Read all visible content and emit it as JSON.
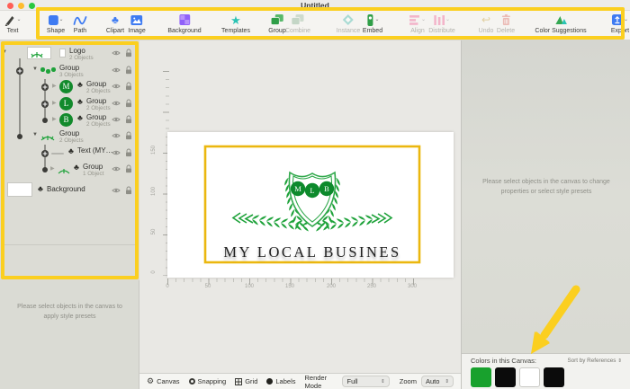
{
  "window": {
    "title": "Untitled"
  },
  "toolbar": {
    "items": [
      {
        "label": "Text"
      },
      {
        "label": "Shape"
      },
      {
        "label": "Path"
      },
      {
        "label": "Clipart"
      },
      {
        "label": "Image"
      },
      {
        "label": "Background"
      },
      {
        "label": "Templates"
      },
      {
        "label": "Group"
      },
      {
        "label": "Combine"
      },
      {
        "label": "Instance"
      },
      {
        "label": "Embed"
      },
      {
        "label": "Align"
      },
      {
        "label": "Distribute"
      },
      {
        "label": "Undo"
      },
      {
        "label": "Delete"
      },
      {
        "label": "Color Suggestions"
      },
      {
        "label": "Export"
      }
    ]
  },
  "layers": {
    "rows": [
      {
        "title": "Logo",
        "sub": "2 Objects"
      },
      {
        "title": "Group",
        "sub": "3 Objects"
      },
      {
        "title": "Group",
        "sub": "2 Objects",
        "badge": "M"
      },
      {
        "title": "Group",
        "sub": "2 Objects",
        "badge": "L"
      },
      {
        "title": "Group",
        "sub": "2 Objects",
        "badge": "B"
      },
      {
        "title": "Group",
        "sub": "2 Objects"
      },
      {
        "title": "Text (MY…",
        "sub": ""
      },
      {
        "title": "Group",
        "sub": "1 Object"
      },
      {
        "title": "Background",
        "sub": ""
      }
    ]
  },
  "left_panel": {
    "message": "Please select objects in the canvas to apply style presets"
  },
  "right_panel": {
    "message": "Please select objects in the canvas to change properties or select style presets",
    "colors_header": "Colors in this Canvas:",
    "sort_label": "Sort by References",
    "swatches": [
      "#18A12D",
      "#0B0B0B",
      "#FFFFFF",
      "#0B0B0B"
    ]
  },
  "canvas": {
    "ruler_v": [
      "150",
      "100",
      "50",
      "0"
    ],
    "ruler_h": [
      "0",
      "50",
      "100",
      "150",
      "200",
      "250",
      "300"
    ],
    "logo": {
      "monogram": [
        "M",
        "L",
        "B"
      ],
      "name_text": "MY LOCAL BUSINES"
    }
  },
  "footer": {
    "toggles": [
      "Canvas",
      "Snapping",
      "Grid",
      "Labels"
    ],
    "render_mode_label": "Render Mode",
    "render_mode_value": "Full",
    "zoom_label": "Zoom",
    "zoom_value": "Auto"
  },
  "colors": {
    "annotation_yellow": "#FBCF20",
    "logo_green": "#1EA23A",
    "gold_border": "#EBB70F"
  }
}
